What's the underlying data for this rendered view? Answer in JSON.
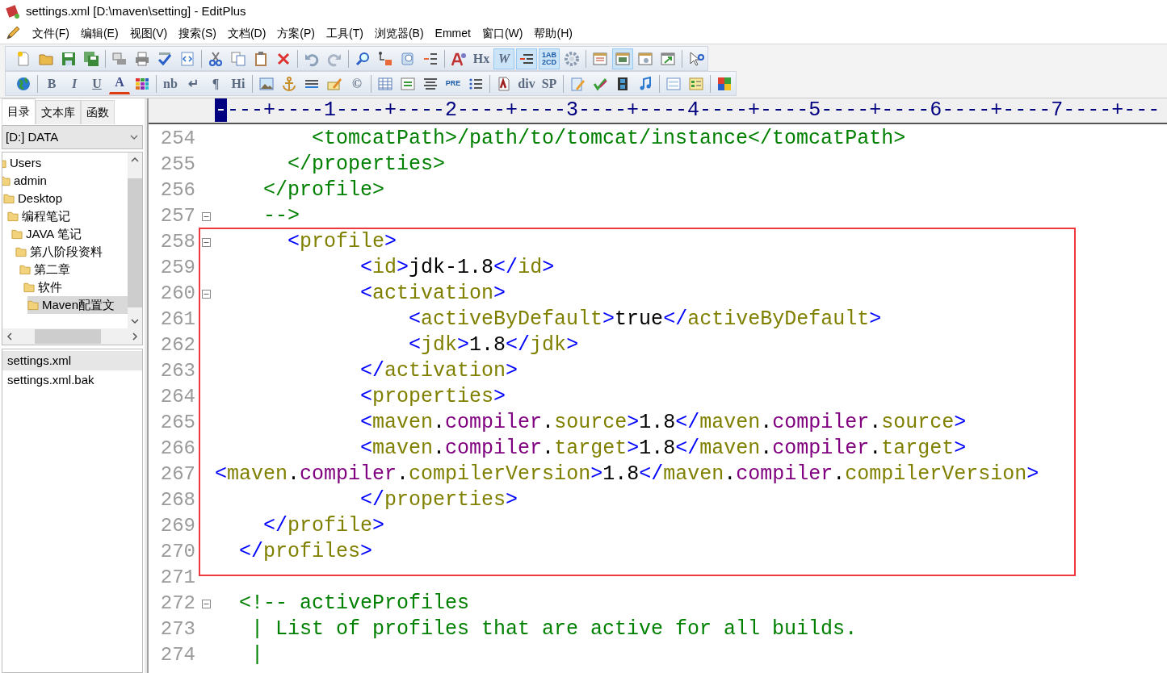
{
  "window": {
    "title": "settings.xml [D:\\maven\\setting] - EditPlus"
  },
  "menu_bar": [
    "文件(F)",
    "编辑(E)",
    "视图(V)",
    "搜索(S)",
    "文档(D)",
    "方案(P)",
    "工具(T)",
    "浏览器(B)",
    "Emmet",
    "窗口(W)",
    "帮助(H)"
  ],
  "toolbars": [
    {
      "items": [
        {
          "kind": "icon",
          "on": false
        },
        {
          "kind": "icon",
          "on": false
        },
        {
          "kind": "icon",
          "on": false
        },
        {
          "kind": "icon",
          "on": false
        },
        {
          "kind": "separator"
        },
        {
          "kind": "icon",
          "on": false
        },
        {
          "kind": "icon",
          "on": false
        },
        {
          "kind": "icon",
          "on": false
        },
        {
          "kind": "icon",
          "on": false
        },
        {
          "kind": "separator"
        },
        {
          "kind": "icon",
          "on": false
        },
        {
          "kind": "icon",
          "on": false
        },
        {
          "kind": "icon",
          "on": false
        },
        {
          "kind": "icon",
          "on": false
        },
        {
          "kind": "separator"
        },
        {
          "kind": "icon",
          "on": false
        },
        {
          "kind": "icon",
          "on": false
        },
        {
          "kind": "separator"
        },
        {
          "kind": "icon",
          "on": false
        },
        {
          "kind": "icon",
          "on": false
        },
        {
          "kind": "icon",
          "on": false
        },
        {
          "kind": "icon",
          "on": false
        },
        {
          "kind": "separator"
        },
        {
          "kind": "icon",
          "on": false
        },
        {
          "kind": "glyph",
          "text": "Hx",
          "on": false
        },
        {
          "kind": "italic-glyph",
          "text": "W",
          "on": true
        },
        {
          "kind": "icon",
          "on": true
        },
        {
          "kind": "small-glyph",
          "text": "1AB 2CD",
          "on": true
        },
        {
          "kind": "icon",
          "on": false
        },
        {
          "kind": "separator"
        },
        {
          "kind": "icon",
          "on": false
        },
        {
          "kind": "icon",
          "on": true
        },
        {
          "kind": "icon",
          "on": false
        },
        {
          "kind": "icon",
          "on": false
        },
        {
          "kind": "separator"
        },
        {
          "kind": "icon",
          "on": false
        }
      ]
    },
    {
      "items": [
        {
          "kind": "icon",
          "on": false
        },
        {
          "kind": "separator"
        },
        {
          "kind": "bold-glyph",
          "text": "B",
          "on": false
        },
        {
          "kind": "italic-glyph",
          "text": "I",
          "on": false
        },
        {
          "kind": "underline-glyph",
          "text": "U",
          "on": false
        },
        {
          "kind": "color-glyph",
          "text": "A",
          "on": false
        },
        {
          "kind": "icon",
          "on": false
        },
        {
          "kind": "separator"
        },
        {
          "kind": "glyph",
          "text": "nb",
          "on": false
        },
        {
          "kind": "glyph",
          "text": "↵",
          "on": false
        },
        {
          "kind": "glyph",
          "text": "¶",
          "on": false
        },
        {
          "kind": "glyph",
          "text": "Hi",
          "on": false
        },
        {
          "kind": "separator"
        },
        {
          "kind": "icon",
          "on": false
        },
        {
          "kind": "icon",
          "on": false
        },
        {
          "kind": "icon",
          "on": false
        },
        {
          "kind": "icon",
          "on": false
        },
        {
          "kind": "glyph",
          "text": "©",
          "on": false
        },
        {
          "kind": "separator"
        },
        {
          "kind": "icon",
          "on": false
        },
        {
          "kind": "icon",
          "on": false
        },
        {
          "kind": "icon",
          "on": false
        },
        {
          "kind": "small-glyph",
          "text": "PRE",
          "on": false
        },
        {
          "kind": "icon",
          "on": false
        },
        {
          "kind": "separator"
        },
        {
          "kind": "icon",
          "on": false
        },
        {
          "kind": "glyph",
          "text": "div",
          "on": false
        },
        {
          "kind": "glyph",
          "text": "SP",
          "on": false
        },
        {
          "kind": "separator"
        },
        {
          "kind": "icon",
          "on": false
        },
        {
          "kind": "icon",
          "on": false
        },
        {
          "kind": "icon",
          "on": false
        },
        {
          "kind": "icon",
          "on": false
        },
        {
          "kind": "separator"
        },
        {
          "kind": "icon",
          "on": false
        },
        {
          "kind": "icon",
          "on": false
        },
        {
          "kind": "separator"
        },
        {
          "kind": "icon",
          "on": false
        }
      ]
    }
  ],
  "sidebar": {
    "tabs": [
      {
        "label": "目录",
        "selected": true
      },
      {
        "label": "文本库",
        "selected": false
      },
      {
        "label": "函数",
        "selected": false
      }
    ],
    "drive_select": {
      "value": "[D:] DATA"
    },
    "tree": [
      {
        "label": "Users",
        "selected": false,
        "children": [
          {
            "label": "admin",
            "selected": false,
            "children": [
              {
                "label": "Desktop",
                "selected": false,
                "children": [
                  {
                    "label": "编程笔记",
                    "selected": false,
                    "children": [
                      {
                        "label": "JAVA 笔记",
                        "selected": false,
                        "children": [
                          {
                            "label": "第八阶段资料",
                            "selected": false,
                            "children": [
                              {
                                "label": "第二章",
                                "selected": false,
                                "children": [
                                  {
                                    "label": "软件",
                                    "selected": false,
                                    "children": [
                                      {
                                        "label": "Maven配置文",
                                        "selected": true
                                      }
                                    ]
                                  }
                                ]
                              }
                            ]
                          }
                        ]
                      }
                    ]
                  }
                ]
              }
            ]
          }
        ]
      }
    ],
    "files": [
      {
        "name": "settings.xml",
        "selected": true
      },
      {
        "name": "settings.xml.bak",
        "selected": false
      }
    ]
  },
  "ruler": {
    "text": "----+----1----+----2----+----3----+----4----+----5----+----6----+----7----+---"
  },
  "editor": {
    "blocks": [
      {
        "boxed": false,
        "lines": [
          {
            "number": "254",
            "fold": false,
            "segments": [
              {
                "kind": "comment",
                "text": "        <tomcatPath>/path/to/tomcat/instance</tomcatPath>"
              }
            ]
          },
          {
            "number": "255",
            "fold": false,
            "segments": [
              {
                "kind": "comment",
                "text": "      </properties>"
              }
            ]
          },
          {
            "number": "256",
            "fold": false,
            "segments": [
              {
                "kind": "comment",
                "text": "    </profile>"
              }
            ]
          },
          {
            "number": "257",
            "fold": true,
            "segments": [
              {
                "kind": "comment",
                "text": "    -->"
              }
            ]
          }
        ]
      },
      {
        "boxed": true,
        "lines": [
          {
            "number": "258",
            "fold": true,
            "segments": [
              {
                "kind": "bracket",
                "text": "      <"
              },
              {
                "kind": "tag",
                "text": "profile"
              },
              {
                "kind": "bracket",
                "text": ">"
              }
            ]
          },
          {
            "number": "259",
            "fold": false,
            "segments": [
              {
                "kind": "bracket",
                "text": "            <"
              },
              {
                "kind": "tag",
                "text": "id"
              },
              {
                "kind": "bracket",
                "text": ">"
              },
              {
                "kind": "text",
                "text": "jdk-1.8"
              },
              {
                "kind": "bracket",
                "text": "</"
              },
              {
                "kind": "tag",
                "text": "id"
              },
              {
                "kind": "bracket",
                "text": ">"
              }
            ]
          },
          {
            "number": "260",
            "fold": true,
            "segments": [
              {
                "kind": "bracket",
                "text": "            <"
              },
              {
                "kind": "tag",
                "text": "activation"
              },
              {
                "kind": "bracket",
                "text": ">"
              }
            ]
          },
          {
            "number": "261",
            "fold": false,
            "segments": [
              {
                "kind": "bracket",
                "text": "                <"
              },
              {
                "kind": "tag",
                "text": "activeByDefault"
              },
              {
                "kind": "bracket",
                "text": ">"
              },
              {
                "kind": "text",
                "text": "true"
              },
              {
                "kind": "bracket",
                "text": "</"
              },
              {
                "kind": "tag",
                "text": "activeByDefault"
              },
              {
                "kind": "bracket",
                "text": ">"
              }
            ]
          },
          {
            "number": "262",
            "fold": false,
            "segments": [
              {
                "kind": "bracket",
                "text": "                <"
              },
              {
                "kind": "tag",
                "text": "jdk"
              },
              {
                "kind": "bracket",
                "text": ">"
              },
              {
                "kind": "text",
                "text": "1.8"
              },
              {
                "kind": "bracket",
                "text": "</"
              },
              {
                "kind": "tag",
                "text": "jdk"
              },
              {
                "kind": "bracket",
                "text": ">"
              }
            ]
          },
          {
            "number": "263",
            "fold": false,
            "segments": [
              {
                "kind": "bracket",
                "text": "            </"
              },
              {
                "kind": "tag",
                "text": "activation"
              },
              {
                "kind": "bracket",
                "text": ">"
              }
            ]
          },
          {
            "number": "264",
            "fold": false,
            "segments": [
              {
                "kind": "bracket",
                "text": "            <"
              },
              {
                "kind": "tag",
                "text": "properties"
              },
              {
                "kind": "bracket",
                "text": ">"
              }
            ]
          },
          {
            "number": "265",
            "fold": false,
            "segments": [
              {
                "kind": "bracket",
                "text": "            <"
              },
              {
                "kind": "tag",
                "text": "maven"
              },
              {
                "kind": "text",
                "text": "."
              },
              {
                "kind": "prefix",
                "text": "compiler"
              },
              {
                "kind": "text",
                "text": "."
              },
              {
                "kind": "tag",
                "text": "source"
              },
              {
                "kind": "bracket",
                "text": ">"
              },
              {
                "kind": "text",
                "text": "1.8"
              },
              {
                "kind": "bracket",
                "text": "</"
              },
              {
                "kind": "tag",
                "text": "maven"
              },
              {
                "kind": "text",
                "text": "."
              },
              {
                "kind": "prefix",
                "text": "compiler"
              },
              {
                "kind": "text",
                "text": "."
              },
              {
                "kind": "tag",
                "text": "source"
              },
              {
                "kind": "bracket",
                "text": ">"
              }
            ]
          },
          {
            "number": "266",
            "fold": false,
            "segments": [
              {
                "kind": "bracket",
                "text": "            <"
              },
              {
                "kind": "tag",
                "text": "maven"
              },
              {
                "kind": "text",
                "text": "."
              },
              {
                "kind": "prefix",
                "text": "compiler"
              },
              {
                "kind": "text",
                "text": "."
              },
              {
                "kind": "tag",
                "text": "target"
              },
              {
                "kind": "bracket",
                "text": ">"
              },
              {
                "kind": "text",
                "text": "1.8"
              },
              {
                "kind": "bracket",
                "text": "</"
              },
              {
                "kind": "tag",
                "text": "maven"
              },
              {
                "kind": "text",
                "text": "."
              },
              {
                "kind": "prefix",
                "text": "compiler"
              },
              {
                "kind": "text",
                "text": "."
              },
              {
                "kind": "tag",
                "text": "target"
              },
              {
                "kind": "bracket",
                "text": ">"
              }
            ]
          },
          {
            "number": "267",
            "fold": false,
            "segments": [
              {
                "kind": "bracket",
                "text": "<"
              },
              {
                "kind": "tag",
                "text": "maven"
              },
              {
                "kind": "text",
                "text": "."
              },
              {
                "kind": "prefix",
                "text": "compiler"
              },
              {
                "kind": "text",
                "text": "."
              },
              {
                "kind": "tag",
                "text": "compilerVersion"
              },
              {
                "kind": "bracket",
                "text": ">"
              },
              {
                "kind": "text",
                "text": "1.8"
              },
              {
                "kind": "bracket",
                "text": "</"
              },
              {
                "kind": "tag",
                "text": "maven"
              },
              {
                "kind": "text",
                "text": "."
              },
              {
                "kind": "prefix",
                "text": "compiler"
              },
              {
                "kind": "text",
                "text": "."
              },
              {
                "kind": "tag",
                "text": "compilerVersion"
              },
              {
                "kind": "bracket",
                "text": ">"
              }
            ]
          },
          {
            "number": "268",
            "fold": false,
            "segments": [
              {
                "kind": "bracket",
                "text": "            </"
              },
              {
                "kind": "tag",
                "text": "properties"
              },
              {
                "kind": "bracket",
                "text": ">"
              }
            ]
          },
          {
            "number": "269",
            "fold": false,
            "segments": [
              {
                "kind": "bracket",
                "text": "    </"
              },
              {
                "kind": "tag",
                "text": "profile"
              },
              {
                "kind": "bracket",
                "text": ">"
              }
            ]
          },
          {
            "number": "270",
            "fold": false,
            "segments": [
              {
                "kind": "bracket",
                "text": "  </"
              },
              {
                "kind": "tag",
                "text": "profiles"
              },
              {
                "kind": "bracket",
                "text": ">"
              }
            ]
          }
        ]
      },
      {
        "boxed": false,
        "lines": [
          {
            "number": "271",
            "fold": false
          },
          {
            "number": "272",
            "fold": true,
            "segments": [
              {
                "kind": "comment",
                "text": "  <!-- activeProfiles"
              }
            ]
          },
          {
            "number": "273",
            "fold": false,
            "segments": [
              {
                "kind": "comment",
                "text": "   | List of profiles that are active for all builds."
              }
            ]
          },
          {
            "number": "274",
            "fold": false,
            "segments": [
              {
                "kind": "comment",
                "text": "   |"
              }
            ]
          }
        ]
      }
    ]
  }
}
